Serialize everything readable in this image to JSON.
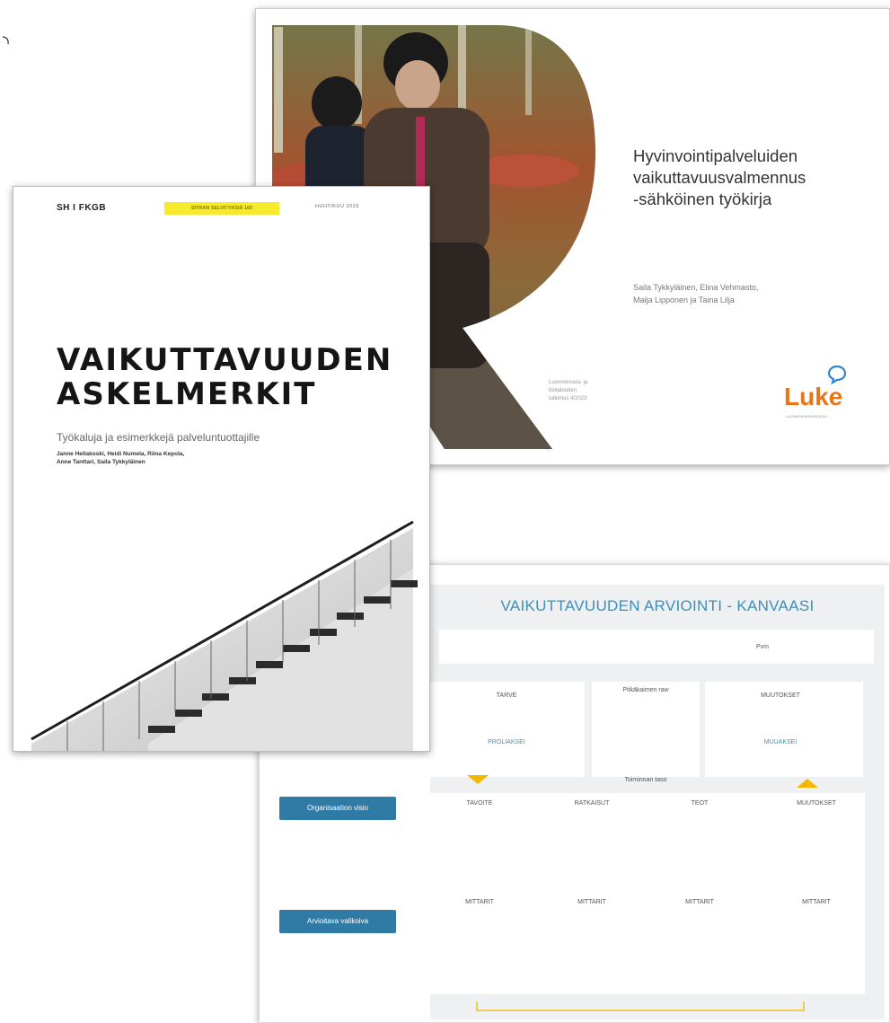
{
  "canvas": {
    "title": "VAIKUTTAVUUDEN ARVIOINTI - KANVAASI",
    "row1_label": "Pvm",
    "col_tarve": "TARVE",
    "top_center": "Pitkäkaimen raw",
    "col_muutokset_top": "MUUTOKSET",
    "tarve_blue": "PROLIAKSEI",
    "muutokset_blue": "MUUAKSEI",
    "middle_center": "Toiminnan taso",
    "col_tavoite": "TAVOITE",
    "col_ratkaisut": "RATKAISUT",
    "col_teot": "TEOT",
    "col_muutokset_bottom": "MUUTOKSET",
    "mittarit": [
      "MITTARIT",
      "MITTARIT",
      "MITTARIT",
      "MITTARIT"
    ],
    "btn_org": "Organisaation visio",
    "btn_arvo": "Arvioitava valikoiva"
  },
  "workbook": {
    "title_lines": [
      "Hyvinvointipalveluiden",
      "vaikuttavuusvalmennus",
      "-sähköinen työkirja"
    ],
    "authors_lines": [
      "Saila Tykkyläinen, Elina Vehmasto,",
      "Maija Lipponen ja Taina Lilja"
    ],
    "series_lines": [
      "Luonnonvara- ja",
      "biotalouden",
      "tutkimus 4/2023"
    ],
    "logo_text": "Luke",
    "logo_sub": "LUONNONVARAKESKUS",
    "brand_orange": "#e8751a",
    "brand_blue": "#2f86c6"
  },
  "book": {
    "logo": "SH I FKGB",
    "tag": "SITRAN SELVITYKSIÄ 160",
    "date": "HUHTIKUU 2019",
    "title_lines": [
      "VAIKUTTAVUUDEN",
      "ASKELMERKIT"
    ],
    "subtitle": "Työkaluja ja esimerkkejä palveluntuottajille",
    "authors_lines": [
      "Janne Hellakoski, Heidi Numela, Riina Kepola,",
      "Anne Tanttari, Saila Tykkyläinen"
    ],
    "tag_color": "#f6ea2c"
  }
}
